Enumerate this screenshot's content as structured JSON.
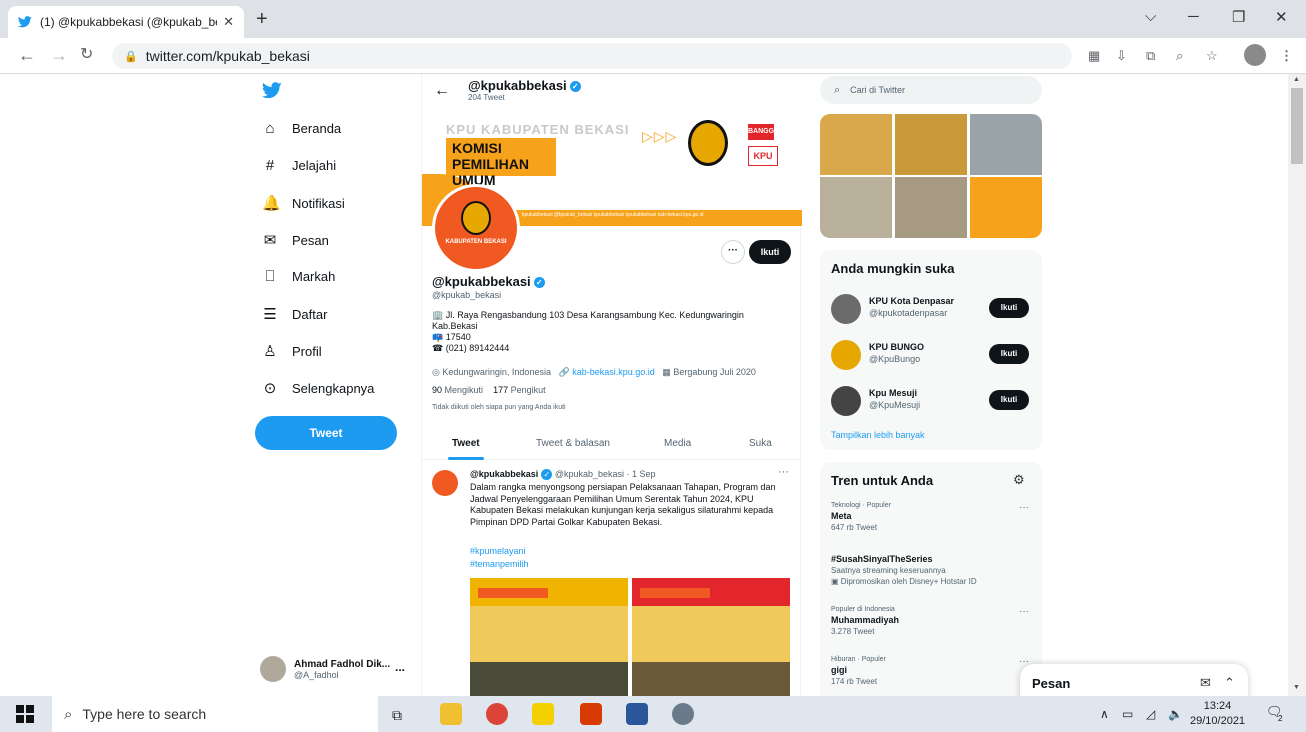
{
  "browser": {
    "tab_title": "(1) @kpukabbekasi (@kpukab_be",
    "tab_close": "✕",
    "new_tab": "+",
    "url": "twitter.com/kpukab_bekasi",
    "win_min": "─",
    "win_max": "❐",
    "win_close": "✕",
    "win_dropdown": "⌵"
  },
  "nav": {
    "items": [
      {
        "label": "Beranda",
        "icon": "home-icon",
        "glyph": "⌂"
      },
      {
        "label": "Jelajahi",
        "icon": "hashtag-icon",
        "glyph": "#"
      },
      {
        "label": "Notifikasi",
        "icon": "bell-icon",
        "glyph": "🔔"
      },
      {
        "label": "Pesan",
        "icon": "mail-icon",
        "glyph": "✉"
      },
      {
        "label": "Markah",
        "icon": "bookmark-icon",
        "glyph": "⎕"
      },
      {
        "label": "Daftar",
        "icon": "list-icon",
        "glyph": "☰"
      },
      {
        "label": "Profil",
        "icon": "person-icon",
        "glyph": "♙"
      },
      {
        "label": "Selengkapnya",
        "icon": "more-circle-icon",
        "glyph": "⊙"
      }
    ],
    "tweet_button": "Tweet",
    "account_name": "Ahmad Fadhol Dik...",
    "account_handle": "@A_fadhol",
    "account_dots": "..."
  },
  "profile": {
    "header_name": "@kpukabbekasi",
    "tweet_count": "204 Tweet",
    "banner_gray": "KPU KABUPATEN BEKASI",
    "banner_line1": "KOMISI",
    "banner_line2": "PEMILIHAN",
    "banner_line3": "UMUM",
    "banner_seal": "BANGGA",
    "banner_kpu": "KPU",
    "banner_socials": "kpukabbekasi  @kpukab_bekasi  kpukabbekasi  kpukabbekasi  kab-bekasi.kpu.go.id",
    "avatar_text": "KABUPATEN BEKASI",
    "more_button": "···",
    "follow_button": "Ikuti",
    "name": "@kpukabbekasi",
    "handle": "@kpukab_bekasi",
    "bio_line1": "🏢 Jl. Raya Rengasbandung 103 Desa Karangsambung Kec. Kedungwaringin Kab.Bekasi",
    "bio_line2": "📪 17540",
    "bio_line3": "☎ (021) 89142444",
    "location": "Kedungwaringin, Indonesia",
    "website": "kab-bekasi.kpu.go.id",
    "joined": "Bergabung Juli 2020",
    "following_count": "90",
    "following_label": "Mengikuti",
    "followers_count": "177",
    "followers_label": "Pengikut",
    "not_followed": "Tidak diikuti oleh siapa pun yang Anda ikuti",
    "tabs": [
      "Tweet",
      "Tweet & balasan",
      "Media",
      "Suka"
    ]
  },
  "tweet": {
    "name": "@kpukabbekasi",
    "meta": "@kpukab_bekasi · 1 Sep",
    "dots": "···",
    "text": "Dalam rangka menyongsong persiapan Pelaksanaan Tahapan, Program dan Jadwal Penyelenggaraan Pemilihan Umum Serentak Tahun 2024, KPU Kabupaten Bekasi melakukan kunjungan kerja sekaligus silaturahmi kepada Pimpinan DPD Partai Golkar Kabupaten Bekasi.",
    "tag1": "#kpumelayani",
    "tag2": "#temanpemilih"
  },
  "sidebar": {
    "search_placeholder": "Cari di Twitter",
    "suggest_title": "Anda mungkin suka",
    "suggestions": [
      {
        "name": "KPU Kota Denpasar",
        "handle": "@kpukotadenpasar",
        "button": "Ikuti"
      },
      {
        "name": "KPU BUNGO",
        "handle": "@KpuBungo",
        "button": "Ikuti"
      },
      {
        "name": "Kpu Mesuji",
        "handle": "@KpuMesuji",
        "button": "Ikuti"
      }
    ],
    "show_more": "Tampilkan lebih banyak",
    "trends_title": "Tren untuk Anda",
    "trends": [
      {
        "context": "Teknologi · Populer",
        "name": "Meta",
        "extra": "647 rb Tweet"
      },
      {
        "context": "",
        "name": "#SusahSinyalTheSeries",
        "extra": "Saatnya streaming keseruannya"
      },
      {
        "context": "Populer di Indonesia",
        "name": "Muhammadiyah",
        "extra": "3.278 Tweet"
      },
      {
        "context": "Hiburan · Populer",
        "name": "gigi",
        "extra": "174 rb Tweet"
      }
    ],
    "promoted": "Dipromosikan oleh Disney+ Hotstar ID",
    "trend_dots": "···"
  },
  "messages": {
    "title": "Pesan",
    "compose_icon": "✉",
    "expand_icon": "⌃"
  },
  "taskbar": {
    "search_placeholder": "Type here to search",
    "time": "13:24",
    "date": "29/10/2021",
    "notif_count": "2"
  },
  "colors": {
    "twitter_blue": "#1d9bf0",
    "kpu_orange": "#f7a21b",
    "kpu_red": "#e3262b",
    "follow_black": "#0f1419"
  }
}
